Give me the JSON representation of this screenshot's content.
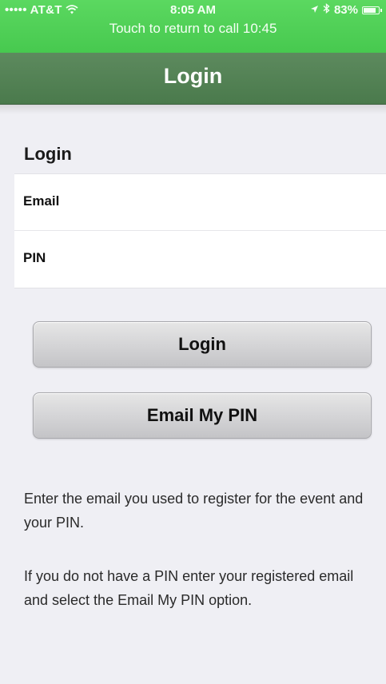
{
  "status_bar": {
    "carrier": "••••• AT&T",
    "wifi_icon": "wifi-icon",
    "time": "8:05 AM",
    "location_icon": "location-arrow-icon",
    "bluetooth_icon": "bluetooth-icon",
    "battery_percent": "83%",
    "battery_level": 0.83
  },
  "call_banner": {
    "text": "Touch to return to call",
    "duration": "10:45"
  },
  "nav": {
    "title": "Login"
  },
  "form": {
    "section_title": "Login",
    "email_label": "Email",
    "email_value": "",
    "pin_label": "PIN",
    "pin_value": ""
  },
  "buttons": {
    "login_label": "Login",
    "email_pin_label": "Email My PIN"
  },
  "help": {
    "paragraph1": "Enter the email you used to register for the event and your PIN.",
    "paragraph2": "If you do not have a PIN enter your registered email and select the Email My PIN option."
  },
  "colors": {
    "status_bar_green": "#4cd964",
    "nav_bar_green": "#557f57",
    "background": "#efeff4"
  }
}
